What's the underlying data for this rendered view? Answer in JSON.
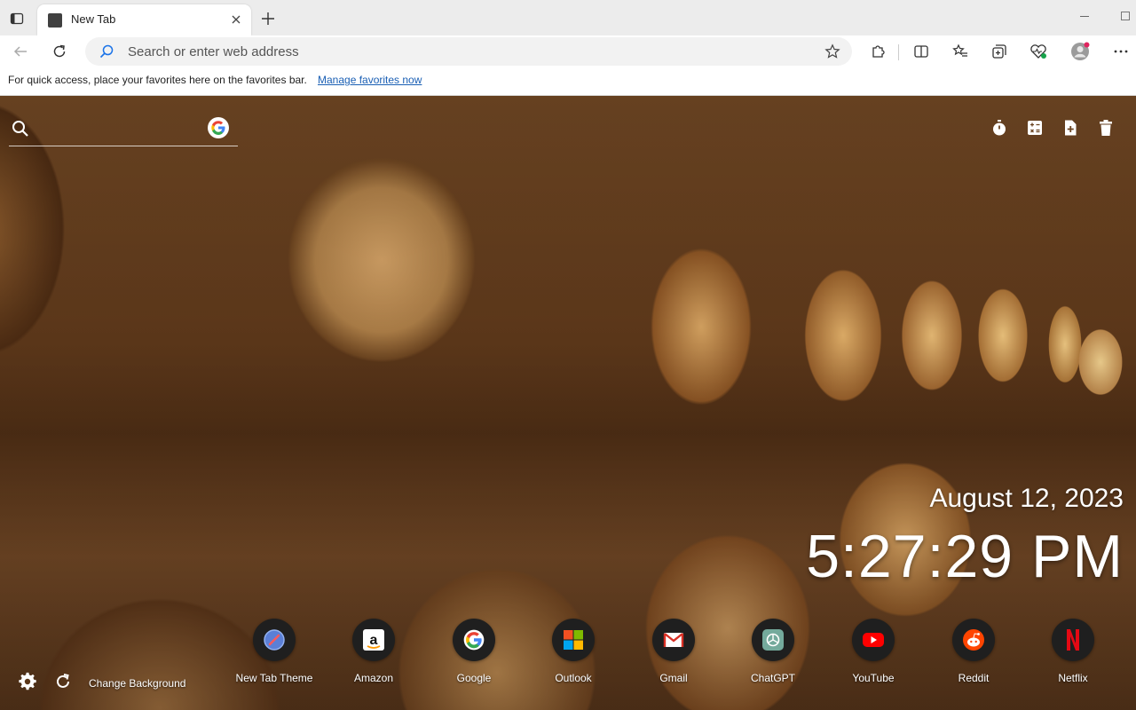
{
  "browser": {
    "tab": {
      "title": "New Tab"
    },
    "address_bar": {
      "placeholder": "Search or enter web address"
    },
    "favorites_bar": {
      "text": "For quick access, place your favorites here on the favorites bar.",
      "link": "Manage favorites now"
    }
  },
  "newtab": {
    "search": {
      "placeholder": "",
      "engine_icon": "google-icon"
    },
    "tools": [
      "timer-icon",
      "calculator-icon",
      "add-note-icon",
      "trash-icon"
    ],
    "date": "August 12, 2023",
    "time": "5:27:29 PM",
    "shortcuts": [
      {
        "label": "New Tab Theme",
        "icon": "new-tab-theme-icon"
      },
      {
        "label": "Amazon",
        "icon": "amazon-icon"
      },
      {
        "label": "Google",
        "icon": "google-icon"
      },
      {
        "label": "Outlook",
        "icon": "microsoft-icon"
      },
      {
        "label": "Gmail",
        "icon": "gmail-icon"
      },
      {
        "label": "ChatGPT",
        "icon": "chatgpt-icon"
      },
      {
        "label": "YouTube",
        "icon": "youtube-icon"
      },
      {
        "label": "Reddit",
        "icon": "reddit-icon"
      },
      {
        "label": "Netflix",
        "icon": "netflix-icon"
      }
    ],
    "change_background": "Change Background"
  },
  "colors": {
    "link": "#1a5fb4",
    "profile_badge": "#e0245e",
    "copilot_badge": "#16a34a"
  }
}
